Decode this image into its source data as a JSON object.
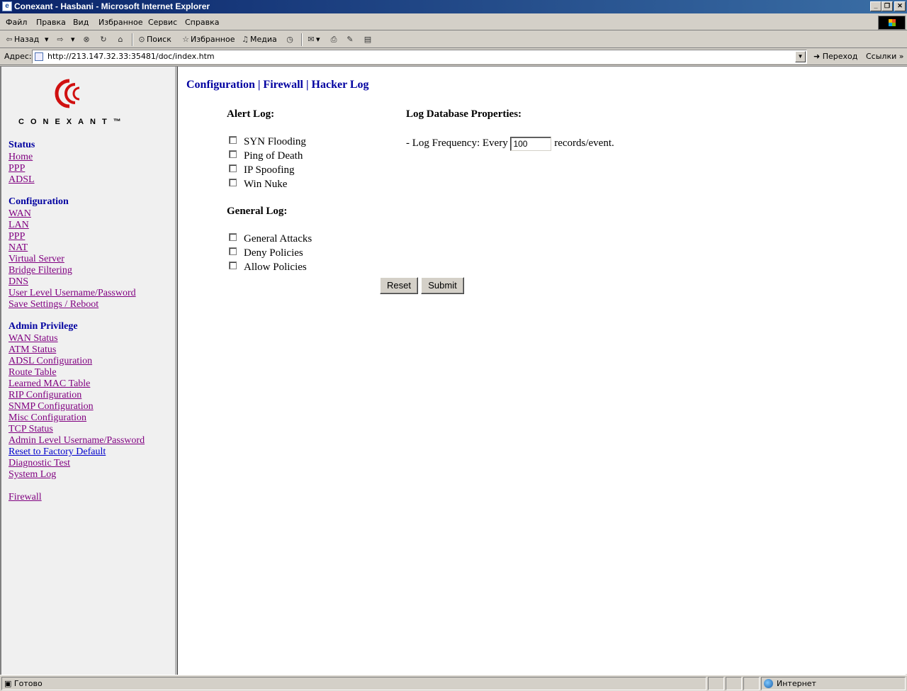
{
  "window": {
    "title": "Conexant - Hasbani - Microsoft Internet Explorer",
    "min_glyph": "_",
    "max_glyph": "❐",
    "close_glyph": "✕"
  },
  "menu": [
    "Файл",
    "Правка",
    "Вид",
    "Избранное",
    "Сервис",
    "Справка"
  ],
  "toolbar": {
    "back": "Назад",
    "search": "Поиск",
    "favorites": "Избранное",
    "media": "Медиа"
  },
  "address": {
    "label": "Адрес:",
    "url": "http://213.147.32.33:35481/doc/index.htm",
    "go": "Переход",
    "links": "Ссылки"
  },
  "sidebar": {
    "logo_text": "CONEXANT™",
    "status_heading": "Status",
    "status_links": [
      "Home",
      "PPP",
      "ADSL"
    ],
    "config_heading": "Configuration",
    "config_links": [
      "WAN",
      "LAN",
      "PPP",
      "NAT",
      "Virtual Server",
      "Bridge Filtering",
      "DNS",
      "User Level Username/Password",
      "Save Settings / Reboot"
    ],
    "admin_heading": "Admin Privilege",
    "admin_links": [
      "WAN Status",
      "ATM Status",
      "ADSL Configuration",
      "Route Table",
      "Learned MAC Table",
      "RIP Configuration",
      "SNMP Configuration",
      "Misc Configuration",
      "TCP Status",
      "Admin Level Username/Password",
      "Reset to Factory Default",
      "Diagnostic Test",
      "System Log"
    ],
    "firewall_link": "Firewall"
  },
  "main": {
    "breadcrumb": "Configuration | Firewall | Hacker Log",
    "alert_log_title": "Alert Log:",
    "alert_items": [
      {
        "label": "SYN Flooding",
        "checked": false
      },
      {
        "label": "Ping of Death",
        "checked": false
      },
      {
        "label": "IP Spoofing",
        "checked": false
      },
      {
        "label": "Win Nuke",
        "checked": false
      }
    ],
    "general_log_title": "General Log:",
    "general_items": [
      {
        "label": "General Attacks",
        "checked": false
      },
      {
        "label": "Deny Policies",
        "checked": false
      },
      {
        "label": "Allow Policies",
        "checked": false
      }
    ],
    "db_title": "Log Database Properties:",
    "freq_prefix": "- Log Frequency: Every",
    "freq_value": "100",
    "freq_suffix": "records/event.",
    "reset_label": "Reset",
    "submit_label": "Submit"
  },
  "status": {
    "text": "Готово",
    "zone": "Интернет"
  }
}
